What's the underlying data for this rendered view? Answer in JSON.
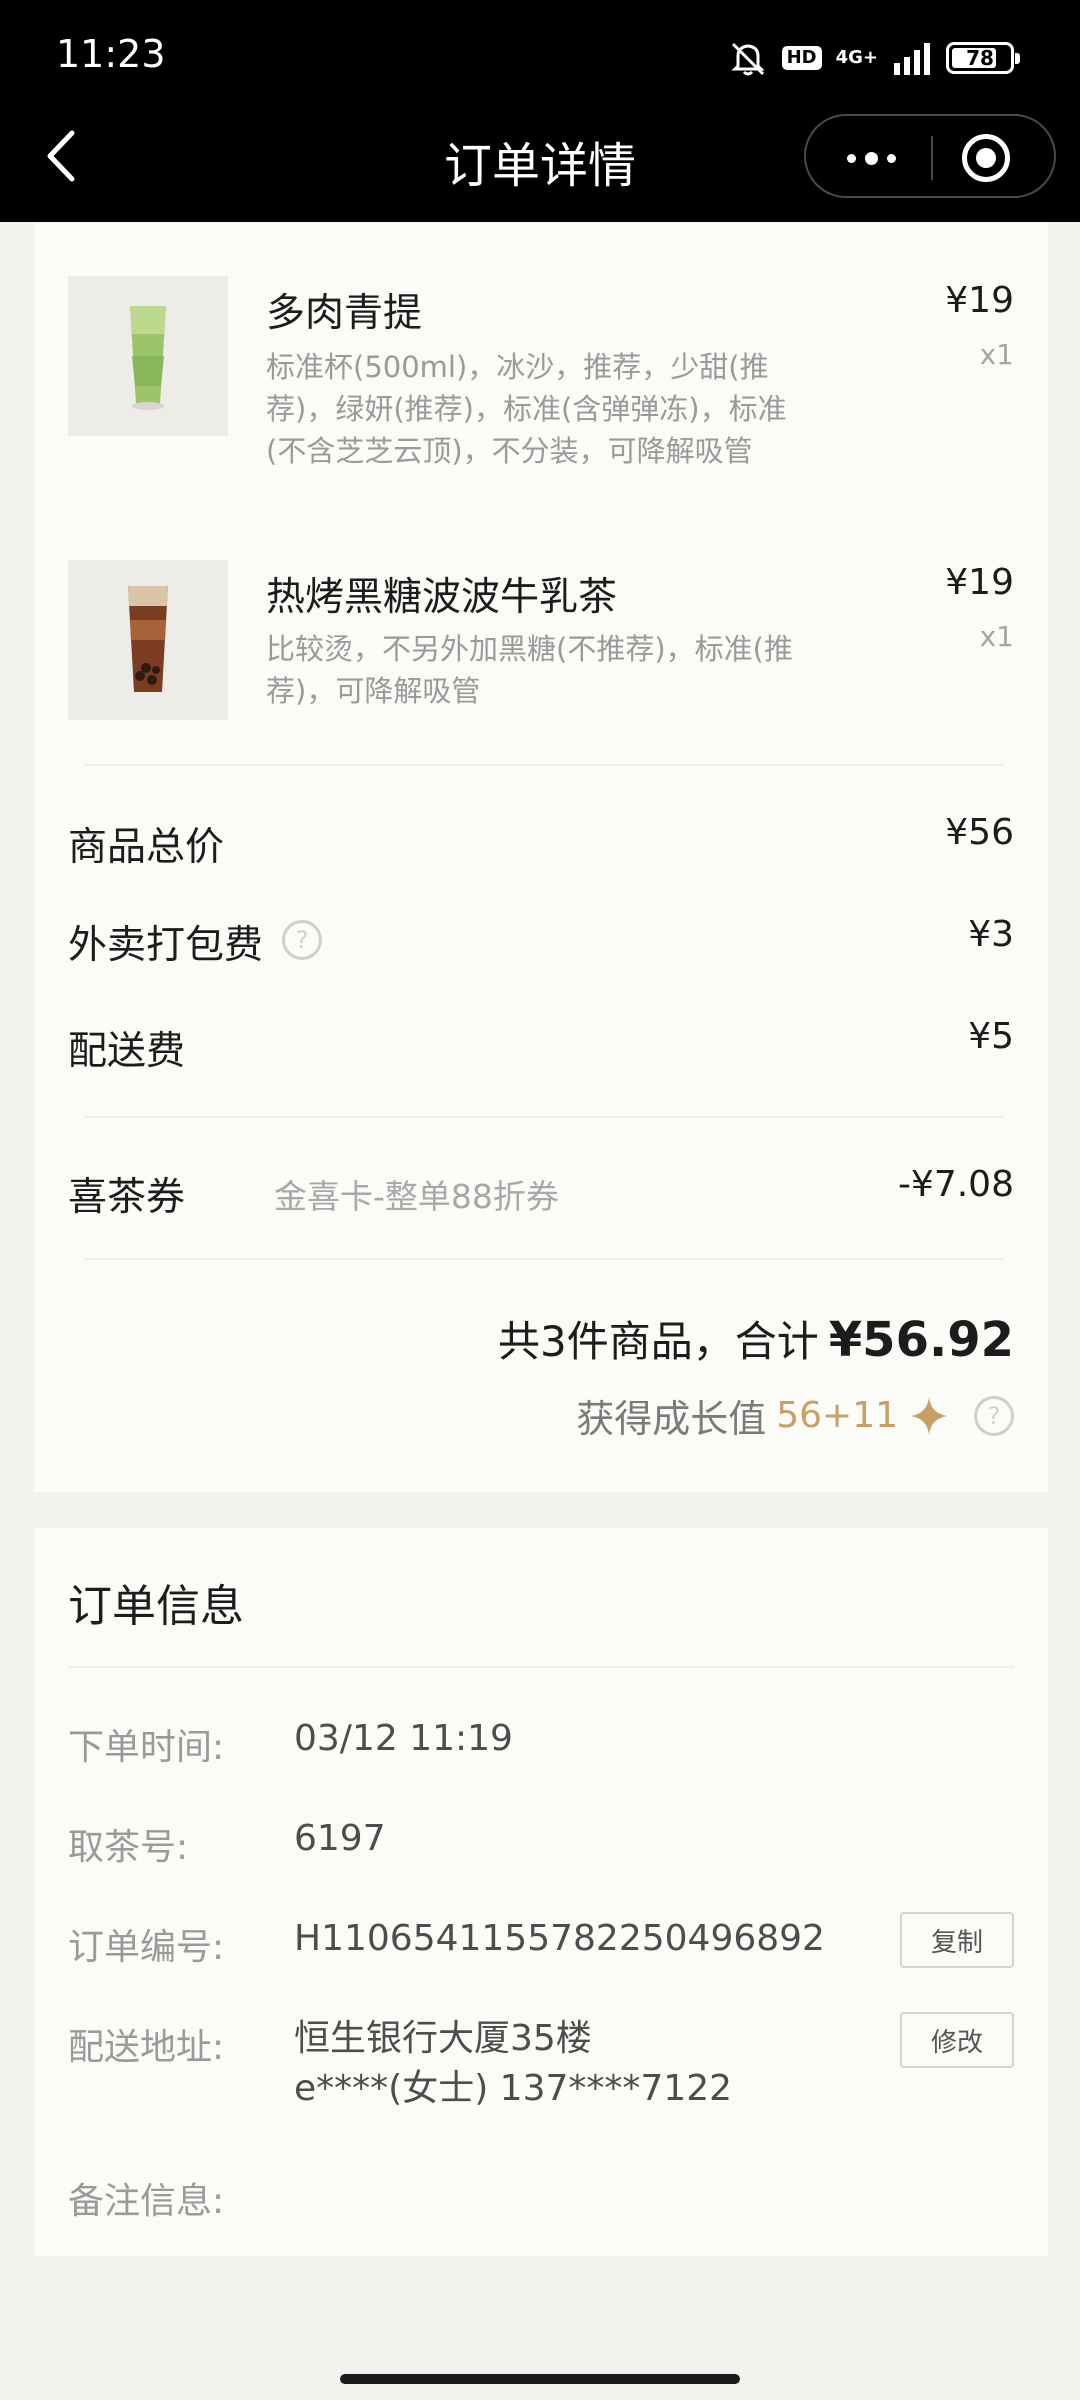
{
  "status_bar": {
    "time": "11:23",
    "hd": "HD",
    "network": "4G+",
    "battery": "78",
    "battery_level": 0.78
  },
  "header": {
    "title": "订单详情",
    "back_icon": "chevron-left-icon",
    "more_icon": "more-dots-icon",
    "close_icon": "target-circle-icon"
  },
  "items": [
    {
      "name": "多肉青提",
      "desc_line1": "标准杯(500ml)，冰沙，推荐，少甜(推",
      "desc_line2": "荐)，绿妍(推荐)，标准(含弹弹冻)，标准",
      "desc_line3": "(不含芝芝云顶)，不分装，可降解吸管",
      "price": "¥19",
      "qty": "x1"
    },
    {
      "name": "热烤黑糖波波牛乳茶",
      "desc_line1": "比较烫，不另外加黑糖(不推荐)，标准(推",
      "desc_line2": "荐)，可降解吸管",
      "price": "¥19",
      "qty": "x1"
    }
  ],
  "totals": {
    "goods_label": "商品总价",
    "goods_value": "¥56",
    "packing_label": "外卖打包费",
    "packing_value": "¥3",
    "delivery_label": "配送费",
    "delivery_value": "¥5",
    "coupon_label": "喜茶券",
    "coupon_name": "金喜卡-整单88折券",
    "coupon_value": "-¥7.08",
    "summary_prefix": "共3件商品，合计",
    "summary_total": "¥56.92",
    "growth_label": "获得成长值",
    "growth_value": "56+11",
    "help_glyph": "?"
  },
  "order_info": {
    "title": "订单信息",
    "time_label": "下单时间:",
    "time_value": "03/12 11:19",
    "pickup_label": "取茶号:",
    "pickup_value": "6197",
    "order_no_label": "订单编号:",
    "order_no_value": "H1106541155782250496892",
    "copy_label": "复制",
    "address_label": "配送地址:",
    "address_line1": "恒生银行大厦35楼",
    "address_line2": "e****(女士) 137****7122",
    "edit_label": "修改",
    "note_label": "备注信息:"
  },
  "colors": {
    "accent_gold": "#c9a063",
    "card_bg": "#fbfbf7",
    "page_bg": "#f2f2ef"
  }
}
